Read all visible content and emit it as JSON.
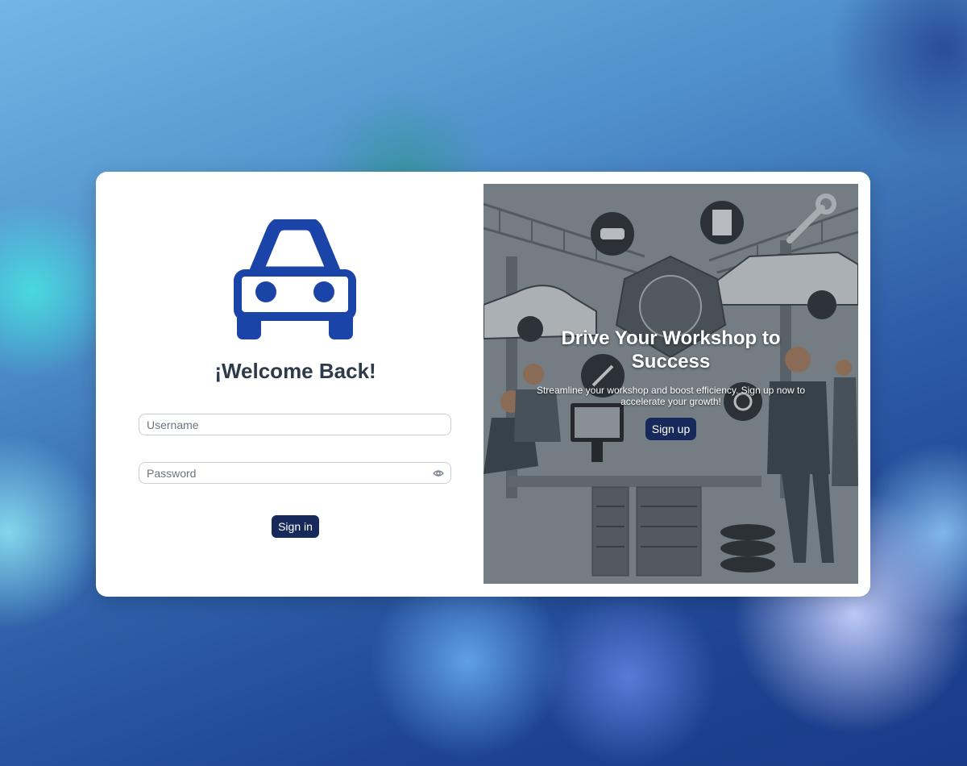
{
  "login": {
    "logo_icon": "car-icon",
    "title": "¡Welcome Back!",
    "username_placeholder": "Username",
    "username_value": "",
    "password_placeholder": "Password",
    "password_value": "",
    "password_toggle_icon": "eye-icon",
    "signin_label": "Sign in"
  },
  "promo": {
    "title": "Drive Your Workshop to Success",
    "text": "Streamline your workshop and boost efficiency. Sign up now to accelerate your growth!",
    "signup_label": "Sign up"
  },
  "colors": {
    "brand_blue": "#1a44a8",
    "button_navy": "#17295a",
    "title_text": "#2d3a4a"
  }
}
